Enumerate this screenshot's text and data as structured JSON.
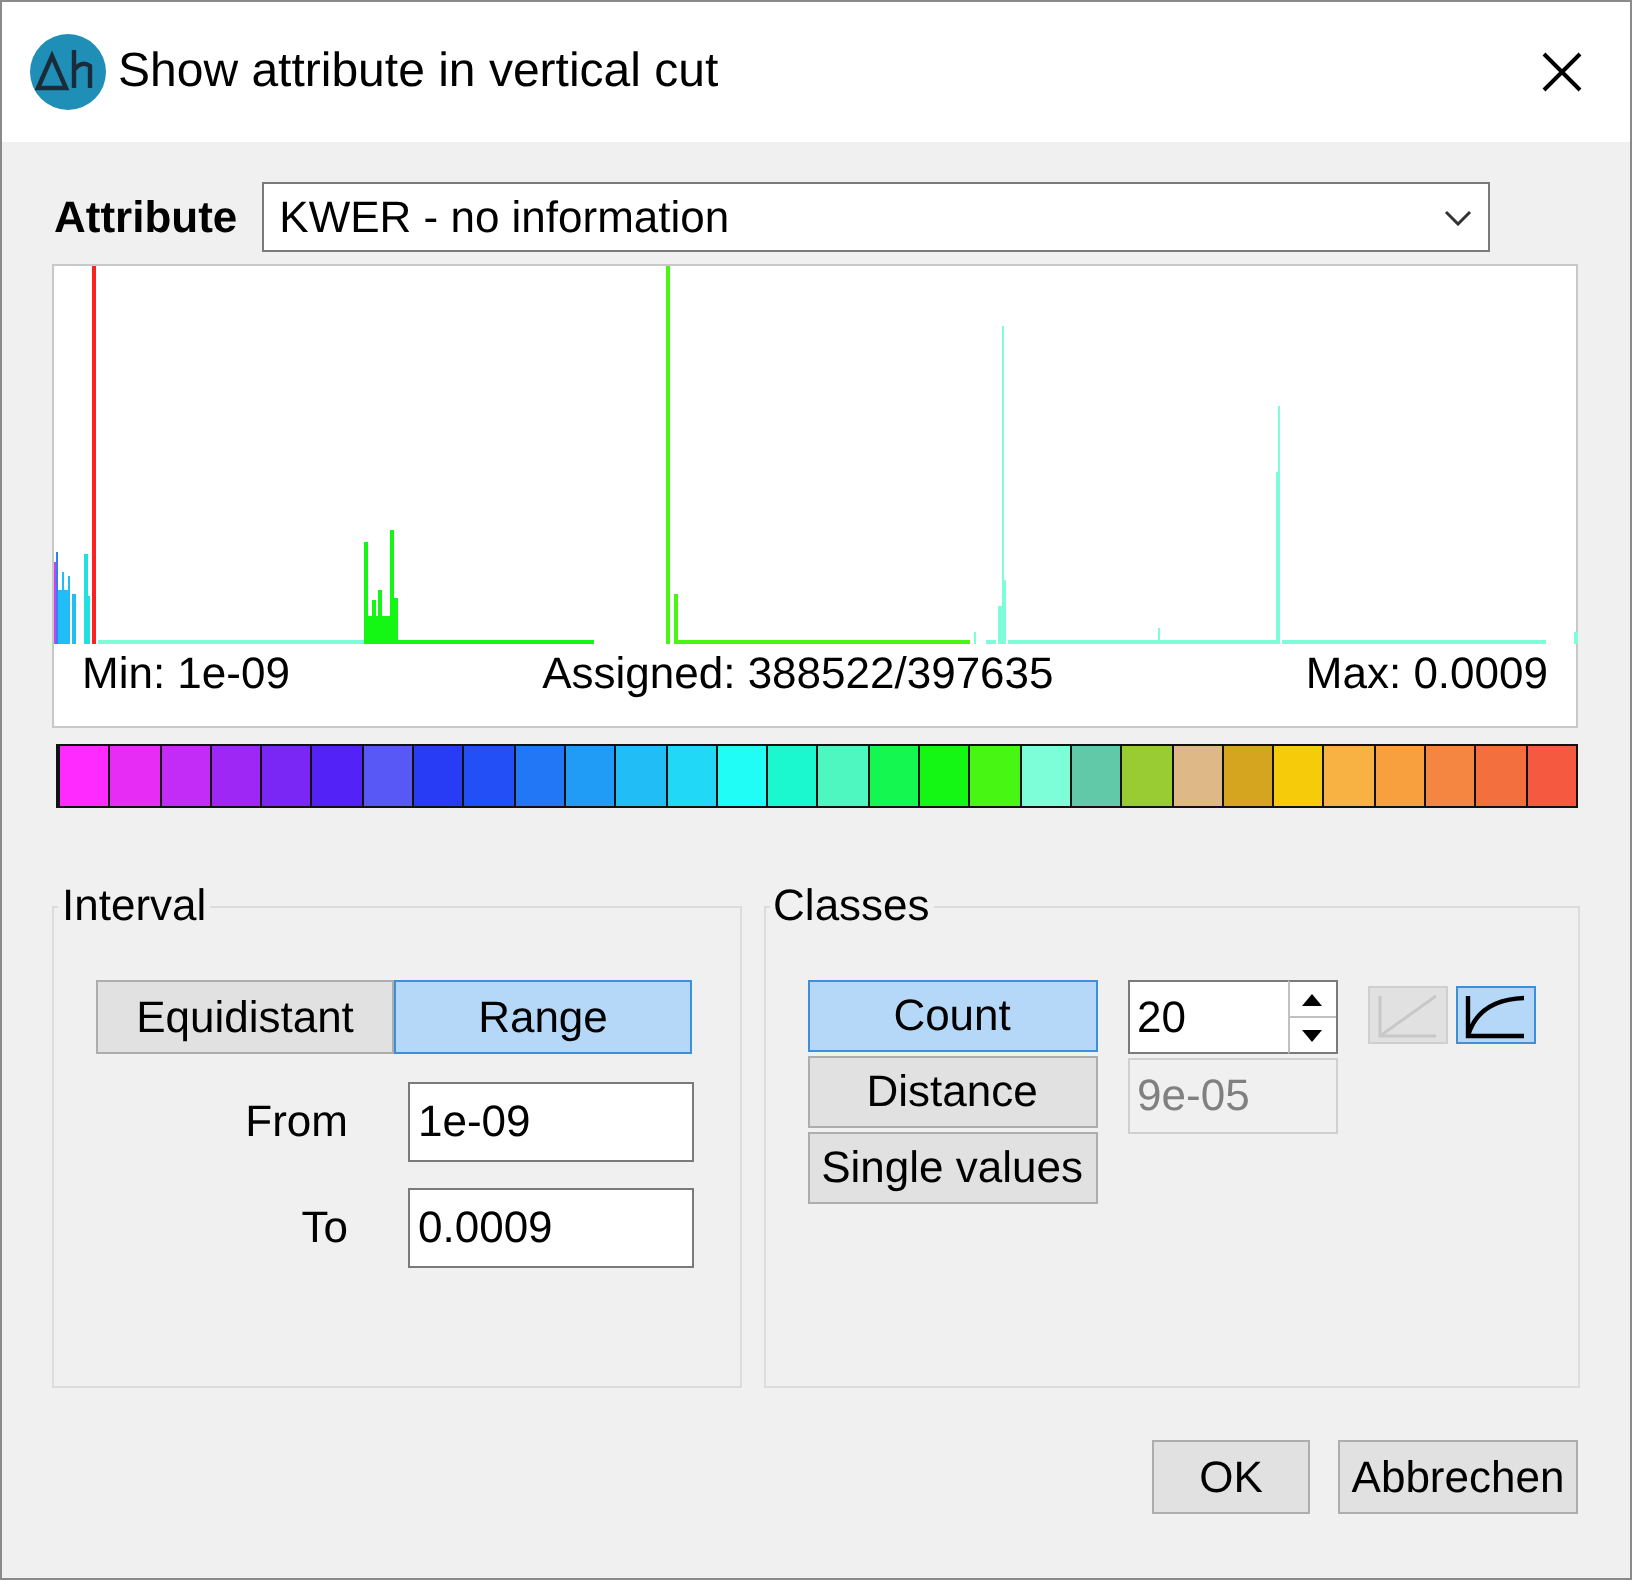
{
  "window": {
    "title": "Show attribute in vertical cut"
  },
  "attribute": {
    "label": "Attribute",
    "value": "KWER - no information"
  },
  "histogram": {
    "min": "Min: 1e-09",
    "assigned": "Assigned: 388522/397635",
    "max": "Max: 0.0009"
  },
  "color_classes": [
    {
      "color": "#ff2aff"
    },
    {
      "color": "#e72cf5"
    },
    {
      "color": "#c22cf6"
    },
    {
      "color": "#9e27f6"
    },
    {
      "color": "#7a27f6"
    },
    {
      "color": "#5322f6"
    },
    {
      "color": "#5858f6"
    },
    {
      "color": "#283cf6"
    },
    {
      "color": "#2350f6"
    },
    {
      "color": "#2277f6"
    },
    {
      "color": "#219cf6"
    },
    {
      "color": "#21bdf6"
    },
    {
      "color": "#21d8f6"
    },
    {
      "color": "#20fdf6"
    },
    {
      "color": "#1bf7ce"
    },
    {
      "color": "#4ff7c0"
    },
    {
      "color": "#14f650"
    },
    {
      "color": "#14f614"
    },
    {
      "color": "#48f614"
    },
    {
      "color": "#7dfed8"
    },
    {
      "color": "#61c8a8"
    },
    {
      "color": "#98cc32"
    },
    {
      "color": "#deb887"
    },
    {
      "color": "#d6a520"
    },
    {
      "color": "#f5cb0a"
    },
    {
      "color": "#f8b244"
    },
    {
      "color": "#f8a03e"
    },
    {
      "color": "#f58642"
    },
    {
      "color": "#f3703e"
    },
    {
      "color": "#f55a40"
    }
  ],
  "interval": {
    "title": "Interval",
    "modes": [
      {
        "label": "Equidistant",
        "selected": false
      },
      {
        "label": "Range",
        "selected": true
      }
    ],
    "from_label": "From",
    "from_value": "1e-09",
    "to_label": "To",
    "to_value": "0.0009"
  },
  "classes": {
    "title": "Classes",
    "modes": [
      {
        "label": "Count",
        "selected": true
      },
      {
        "label": "Distance",
        "selected": false
      },
      {
        "label": "Single values",
        "selected": false
      }
    ],
    "count": "20",
    "distance": {
      "value": "9e-05",
      "disabled": true
    },
    "scales": [
      {
        "kind": "linear",
        "selected": false
      },
      {
        "kind": "logarithmic",
        "selected": true
      }
    ]
  },
  "buttons": [
    "OK",
    "Abbrechen"
  ]
}
